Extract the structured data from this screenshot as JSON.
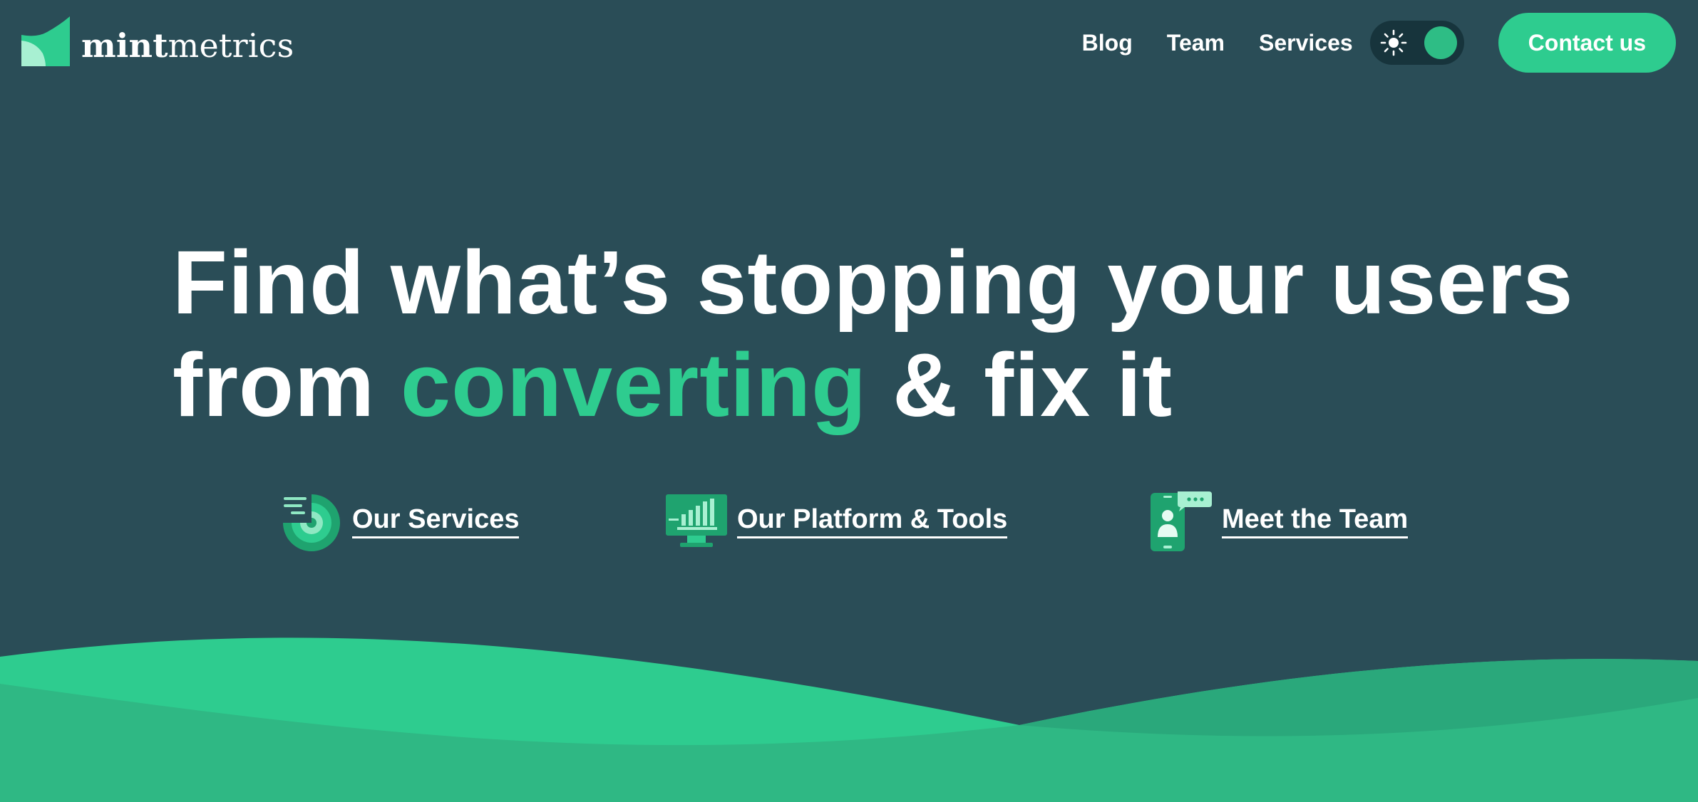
{
  "brand": {
    "name_bold": "mint",
    "name_light": "metrics",
    "logo_icon": "mintmetrics-logo-icon",
    "colors": {
      "background": "#2a4d57",
      "accent": "#2ecc8f",
      "toggle_track": "#17343c"
    }
  },
  "nav": {
    "links": [
      {
        "label": "Blog"
      },
      {
        "label": "Team"
      },
      {
        "label": "Services"
      }
    ],
    "theme_toggle": {
      "icon": "sun-icon",
      "state": "light"
    },
    "contact_label": "Contact us"
  },
  "hero": {
    "line1": "Find what’s stopping your users",
    "line2_before": "from ",
    "line2_accent": "converting",
    "line2_after": " & fix it"
  },
  "quick_links": [
    {
      "label": "Our Services",
      "icon": "target-chart-icon"
    },
    {
      "label": "Our Platform & Tools",
      "icon": "monitor-chart-icon"
    },
    {
      "label": "Meet the Team",
      "icon": "phone-chat-icon"
    }
  ]
}
